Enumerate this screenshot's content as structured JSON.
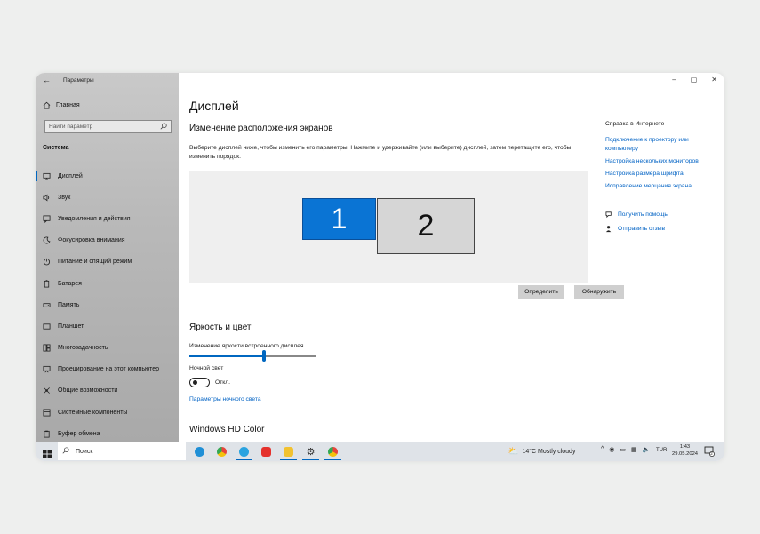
{
  "window": {
    "app_title": "Параметры",
    "controls": {
      "minimize": "–",
      "maximize": "▢",
      "close": "✕"
    }
  },
  "sidebar": {
    "home_label": "Главная",
    "search_placeholder": "Найти параметр",
    "section": "Система",
    "items": [
      {
        "label": "Дисплей",
        "icon": "monitor-icon",
        "active": true
      },
      {
        "label": "Звук",
        "icon": "speaker-icon"
      },
      {
        "label": "Уведомления и действия",
        "icon": "notification-icon"
      },
      {
        "label": "Фокусировка внимания",
        "icon": "moon-icon"
      },
      {
        "label": "Питание и спящий режим",
        "icon": "power-icon"
      },
      {
        "label": "Батарея",
        "icon": "battery-icon"
      },
      {
        "label": "Память",
        "icon": "storage-icon"
      },
      {
        "label": "Планшет",
        "icon": "tablet-icon"
      },
      {
        "label": "Многозадачность",
        "icon": "multitask-icon"
      },
      {
        "label": "Проецирование на этот компьютер",
        "icon": "project-icon"
      },
      {
        "label": "Общие возможности",
        "icon": "shared-icon"
      },
      {
        "label": "Системные компоненты",
        "icon": "components-icon"
      },
      {
        "label": "Буфер обмена",
        "icon": "clipboard-icon"
      }
    ]
  },
  "main": {
    "title": "Дисплей",
    "arrange": {
      "heading": "Изменение расположения экранов",
      "description": "Выберите дисплей ниже, чтобы изменить его параметры. Нажмите и удерживайте (или выберите) дисплей, затем перетащите его, чтобы изменить порядок.",
      "monitor1": "1",
      "monitor2": "2",
      "identify_button": "Определить",
      "detect_button": "Обнаружить"
    },
    "brightness": {
      "heading": "Яркость и цвет",
      "slider_label": "Изменение яркости встроенного дисплея",
      "slider_value_percent": 59,
      "night_light_label": "Ночной свет",
      "night_light_state": "Откл.",
      "night_light_link": "Параметры ночного света"
    },
    "hdr_heading": "Windows HD Color"
  },
  "right_panel": {
    "title": "Справка в Интернете",
    "links": [
      "Подключение к проектору или компьютеру",
      "Настройка нескольких мониторов",
      "Настройка размера шрифта",
      "Исправление мерцания экрана"
    ],
    "get_help": "Получить помощь",
    "feedback": "Отправить отзыв"
  },
  "taskbar": {
    "search_label": "Поиск",
    "apps": [
      {
        "name": "edge",
        "color": "#1f8fd6",
        "open": false
      },
      {
        "name": "chrome",
        "color": "#e8453c",
        "open": false
      },
      {
        "name": "telegram",
        "color": "#2aa3e0",
        "open": true
      },
      {
        "name": "anydesk",
        "color": "#e5322d",
        "open": false
      },
      {
        "name": "file-explorer",
        "color": "#f2c230",
        "open": true
      },
      {
        "name": "settings",
        "color": "#444444",
        "open": true
      },
      {
        "name": "chrome-2",
        "color": "#e8453c",
        "open": true
      }
    ],
    "weather": "14°C  Mostly cloudy",
    "language": "TUR",
    "time": "1:43",
    "date": "29.05.2024",
    "notifications": "2"
  },
  "colors": {
    "accent": "#0067c0",
    "link": "#0062c4",
    "monitor1": "#0a74d4"
  }
}
